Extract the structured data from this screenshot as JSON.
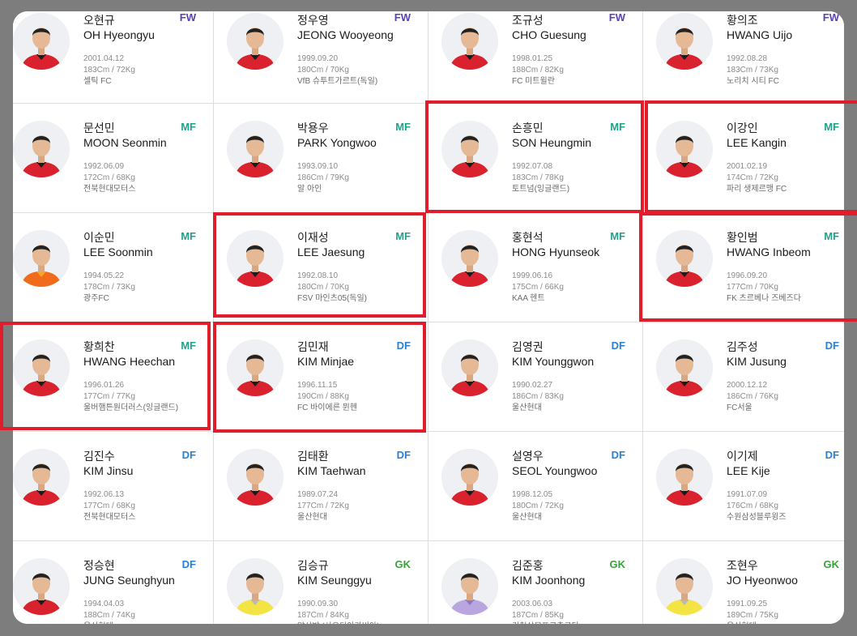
{
  "highlight_color": "#e01e2b",
  "position_colors": {
    "FW": "#5b3fb6",
    "MF": "#23a08a",
    "DF": "#2a7fd6",
    "GK": "#3aa23a"
  },
  "players": [
    {
      "name_ko": "오현규",
      "name_en": "OH Hyeongyu",
      "position": "FW",
      "birth": "2001.04.12",
      "body": "183Cm / 72Kg",
      "club": "셀틱 FC",
      "kit": "red"
    },
    {
      "name_ko": "정우영",
      "name_en": "JEONG Wooyeong",
      "position": "FW",
      "birth": "1999.09.20",
      "body": "180Cm / 70Kg",
      "club": "VfB 슈투트가르트(독일)",
      "kit": "red"
    },
    {
      "name_ko": "조규성",
      "name_en": "CHO Guesung",
      "position": "FW",
      "birth": "1998.01.25",
      "body": "188Cm / 82Kg",
      "club": "FC 미트윌란",
      "kit": "red"
    },
    {
      "name_ko": "황의조",
      "name_en": "HWANG Uijo",
      "position": "FW",
      "birth": "1992.08.28",
      "body": "183Cm / 73Kg",
      "club": "노리치 시티 FC",
      "kit": "red"
    },
    {
      "name_ko": "문선민",
      "name_en": "MOON Seonmin",
      "position": "MF",
      "birth": "1992.06.09",
      "body": "172Cm / 68Kg",
      "club": "전북현대모터스",
      "kit": "red"
    },
    {
      "name_ko": "박용우",
      "name_en": "PARK Yongwoo",
      "position": "MF",
      "birth": "1993.09.10",
      "body": "186Cm / 79Kg",
      "club": "알 아인",
      "kit": "red"
    },
    {
      "name_ko": "손흥민",
      "name_en": "SON Heungmin",
      "position": "MF",
      "birth": "1992.07.08",
      "body": "183Cm / 78Kg",
      "club": "토트넘(잉글랜드)",
      "kit": "red"
    },
    {
      "name_ko": "이강인",
      "name_en": "LEE Kangin",
      "position": "MF",
      "birth": "2001.02.19",
      "body": "174Cm / 72Kg",
      "club": "파리 생제르맹 FC",
      "kit": "red"
    },
    {
      "name_ko": "이순민",
      "name_en": "LEE Soonmin",
      "position": "MF",
      "birth": "1994.05.22",
      "body": "178Cm / 73Kg",
      "club": "광주FC",
      "kit": "orange"
    },
    {
      "name_ko": "이재성",
      "name_en": "LEE Jaesung",
      "position": "MF",
      "birth": "1992.08.10",
      "body": "180Cm / 70Kg",
      "club": "FSV 마인츠05(독일)",
      "kit": "red"
    },
    {
      "name_ko": "홍현석",
      "name_en": "HONG Hyunseok",
      "position": "MF",
      "birth": "1999.06.16",
      "body": "175Cm / 66Kg",
      "club": "KAA 헨트",
      "kit": "red"
    },
    {
      "name_ko": "황인범",
      "name_en": "HWANG Inbeom",
      "position": "MF",
      "birth": "1996.09.20",
      "body": "177Cm / 70Kg",
      "club": "FK 츠르베나 즈베즈다",
      "kit": "red"
    },
    {
      "name_ko": "황희찬",
      "name_en": "HWANG Heechan",
      "position": "MF",
      "birth": "1996.01.26",
      "body": "177Cm / 77Kg",
      "club": "울버햄튼원더러스(잉글랜드)",
      "kit": "red"
    },
    {
      "name_ko": "김민재",
      "name_en": "KIM Minjae",
      "position": "DF",
      "birth": "1996.11.15",
      "body": "190Cm / 88Kg",
      "club": "FC 바이에른 뮌헨",
      "kit": "red"
    },
    {
      "name_ko": "김영권",
      "name_en": "KIM Younggwon",
      "position": "DF",
      "birth": "1990.02.27",
      "body": "186Cm / 83Kg",
      "club": "울산현대",
      "kit": "red"
    },
    {
      "name_ko": "김주성",
      "name_en": "KIM Jusung",
      "position": "DF",
      "birth": "2000.12.12",
      "body": "186Cm / 76Kg",
      "club": "FC서울",
      "kit": "red"
    },
    {
      "name_ko": "김진수",
      "name_en": "KIM Jinsu",
      "position": "DF",
      "birth": "1992.06.13",
      "body": "177Cm / 68Kg",
      "club": "전북현대모터스",
      "kit": "red"
    },
    {
      "name_ko": "김태환",
      "name_en": "KIM Taehwan",
      "position": "DF",
      "birth": "1989.07.24",
      "body": "177Cm / 72Kg",
      "club": "울산현대",
      "kit": "red"
    },
    {
      "name_ko": "설영우",
      "name_en": "SEOL Youngwoo",
      "position": "DF",
      "birth": "1998.12.05",
      "body": "180Cm / 72Kg",
      "club": "울산현대",
      "kit": "red"
    },
    {
      "name_ko": "이기제",
      "name_en": "LEE Kije",
      "position": "DF",
      "birth": "1991.07.09",
      "body": "176Cm / 68Kg",
      "club": "수원삼성블루윙즈",
      "kit": "red"
    },
    {
      "name_ko": "정승현",
      "name_en": "JUNG Seunghyun",
      "position": "DF",
      "birth": "1994.04.03",
      "body": "188Cm / 74Kg",
      "club": "울산현대",
      "kit": "red"
    },
    {
      "name_ko": "김승규",
      "name_en": "KIM Seunggyu",
      "position": "GK",
      "birth": "1990.09.30",
      "body": "187Cm / 84Kg",
      "club": "알샤밥 (사우디아라비아)",
      "kit": "yellow"
    },
    {
      "name_ko": "김준홍",
      "name_en": "KIM Joonhong",
      "position": "GK",
      "birth": "2003.06.03",
      "body": "187Cm / 85Kg",
      "club": "김천상무프로축구단",
      "kit": "purple"
    },
    {
      "name_ko": "조현우",
      "name_en": "JO Hyeonwoo",
      "position": "GK",
      "birth": "1991.09.25",
      "body": "189Cm / 75Kg",
      "club": "울산현대",
      "kit": "yellow"
    }
  ],
  "highlighted_players": [
    "SON Heungmin",
    "LEE Kangin",
    "LEE Jaesung",
    "HWANG Inbeom",
    "HWANG Heechan",
    "KIM Minjae"
  ]
}
